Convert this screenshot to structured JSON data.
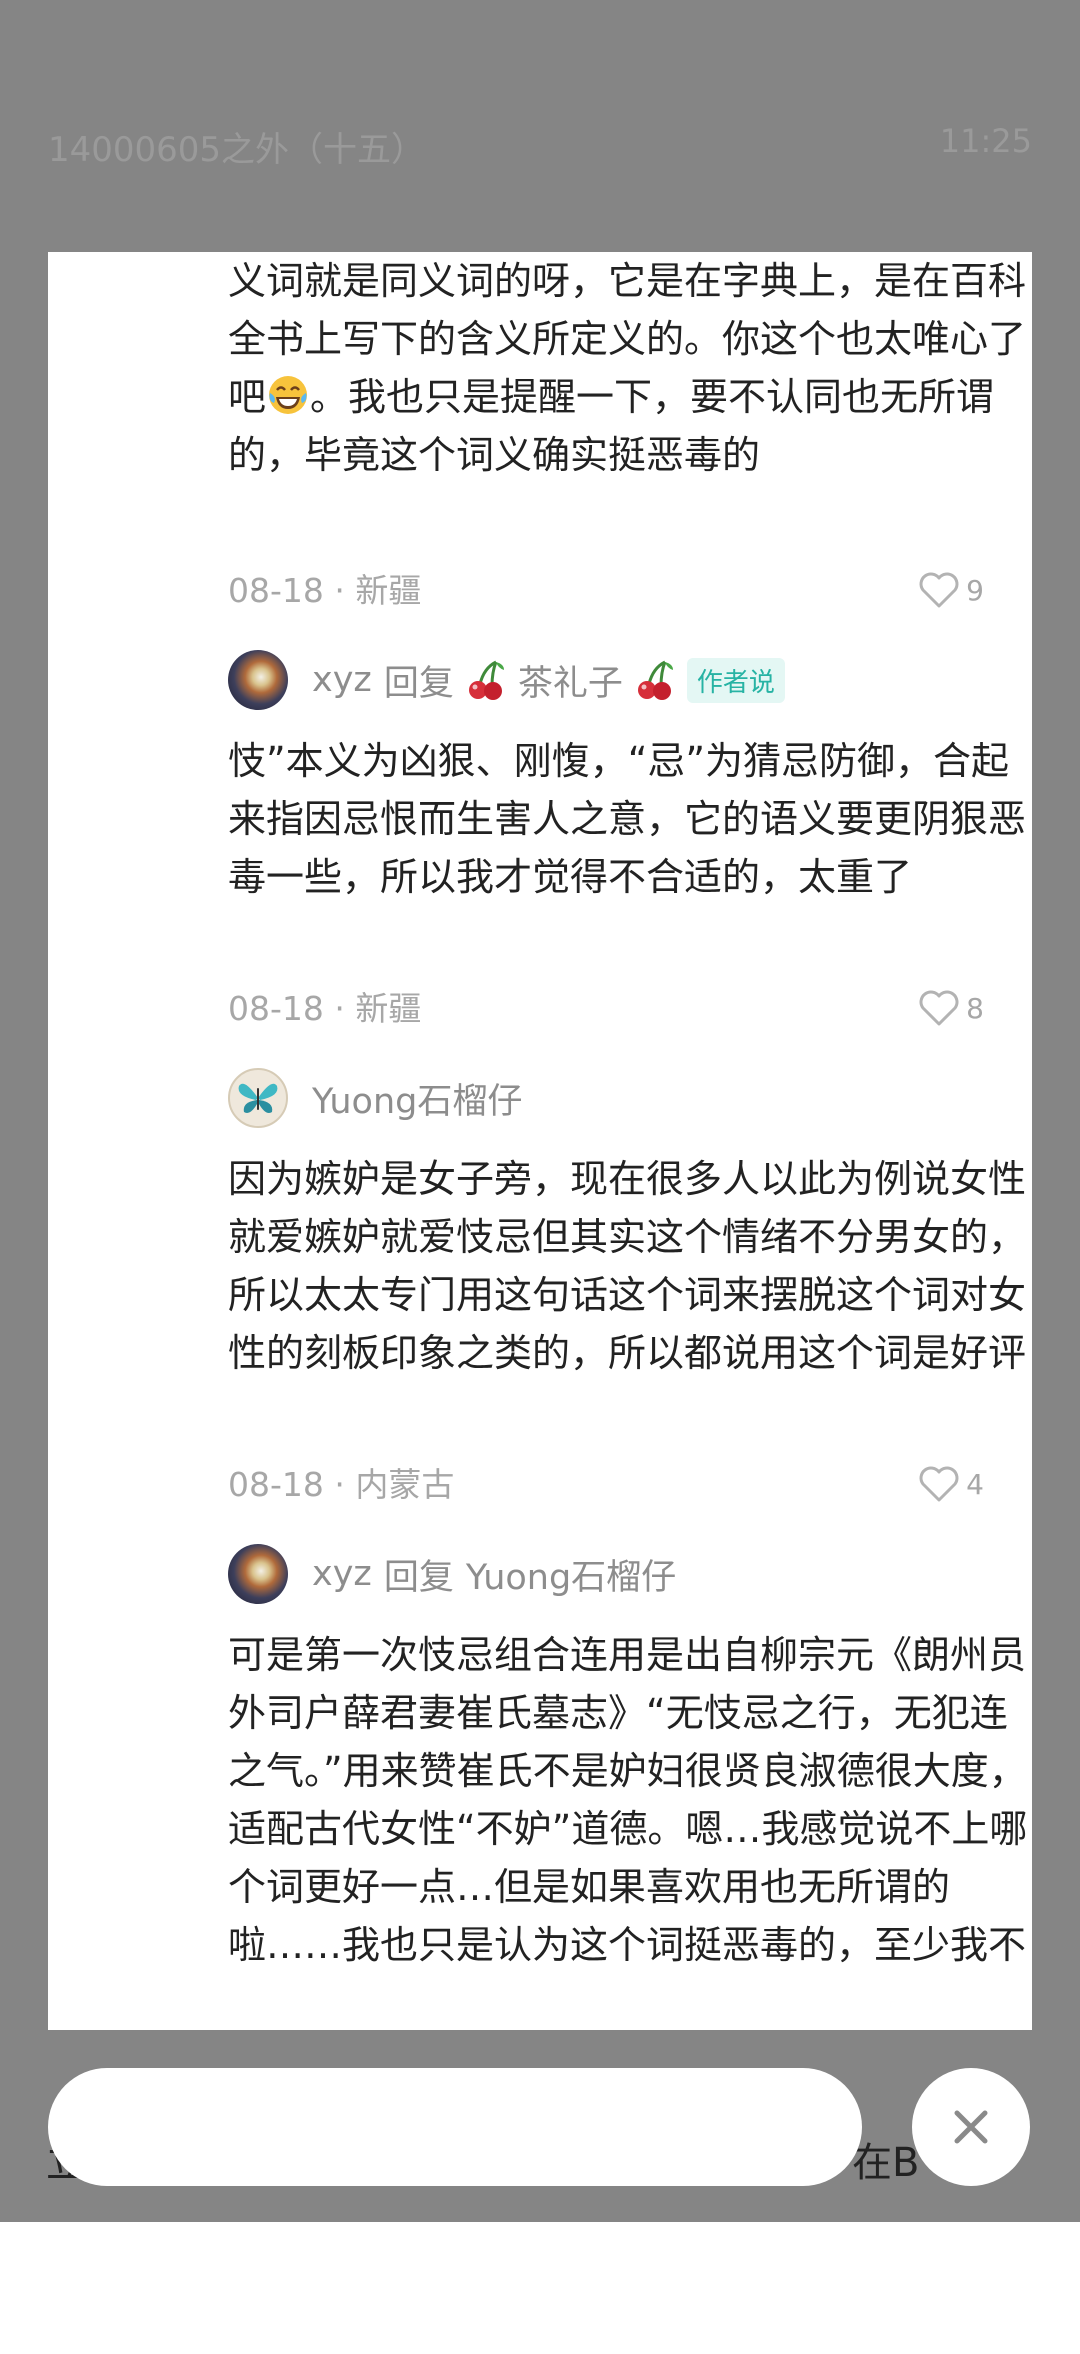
{
  "reader": {
    "chapter_title": "14000605之外（十五）",
    "time": "11:25",
    "peek_left": "立",
    "peek_right": "在B"
  },
  "comments": [
    {
      "body": "义词就是同义词的呀，它是在字典上，是在百科全书上写下的含义所定义的。你这个也太唯心了吧",
      "body_tail": "。我也只是提醒一下，要不认同也无所谓的，毕竟这个词义确实挺恶毒的",
      "emoji": "face-with-tears-of-joy",
      "date": "08-18",
      "location": "新疆",
      "likes": "9"
    },
    {
      "user": "xyz",
      "reply_word": "回复",
      "reply_to": "茶礼子",
      "badge": "作者说",
      "body": "忮”本义为凶狠、刚愎，“忌”为猜忌防御，合起来指因忌恨而生害人之意，它的语义要更阴狠恶毒一些，所以我才觉得不合适的，太重了",
      "date": "08-18",
      "location": "新疆",
      "likes": "8"
    },
    {
      "user": "Yuong石榴仔",
      "body": "因为嫉妒是女子旁，现在很多人以此为例说女性就爱嫉妒就爱忮忌但其实这个情绪不分男女的，所以太太专门用这句话这个词来摆脱这个词对女性的刻板印象之类的，所以都说用这个词是好评",
      "date": "08-18",
      "location": "内蒙古",
      "likes": "4"
    },
    {
      "user": "xyz",
      "reply_word": "回复",
      "reply_to": "Yuong石榴仔",
      "body": "可是第一次忮忌组合连用是出自柳宗元《朗州员外司户薛君妻崔氏墓志》“无忮忌之行，无犯连之气。”用来赞崔氏不是妒妇很贤良淑德很大度，适配古代女性“不妒”道德。嗯…我感觉说不上哪个词更好一点…但是如果喜欢用也无所谓的啦……我也只是认为这个词挺恶毒的，至少我不"
    }
  ],
  "meta_separator": "·",
  "input": {
    "placeholder": ""
  },
  "colors": {
    "backdrop": "#858585",
    "author_badge_bg": "#e4f7f4",
    "author_badge_text": "#27b3a4",
    "meta_text": "#a7a7a7"
  },
  "icons": {
    "like": "heart-outline-icon",
    "close": "close-icon",
    "cherry": "cherry-icon"
  }
}
